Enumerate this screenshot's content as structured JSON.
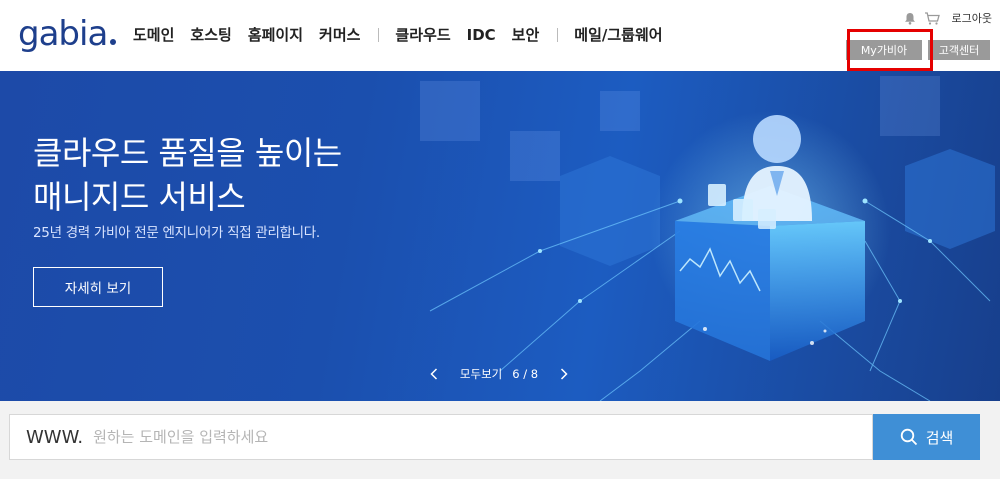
{
  "logo": {
    "text": "gabia"
  },
  "gnb": {
    "items": [
      "도메인",
      "호스팅",
      "홈페이지",
      "커머스",
      "클라우드",
      "IDC",
      "보안",
      "메일/그룹웨어"
    ]
  },
  "util": {
    "bell_icon": "bell-icon",
    "cart_icon": "cart-icon",
    "logout_label": "로그아웃"
  },
  "header_buttons": {
    "mygabia_label": "My가비아",
    "customer_center_label": "고객센터"
  },
  "hero": {
    "title_line1": "클라우드 품질을 높이는",
    "title_line2": "매니지드 서비스",
    "subtitle": "25년 경력 가비아 전문 엔지니어가 직접 관리합니다.",
    "cta_label": "자세히 보기",
    "pager": {
      "all_label": "모두보기",
      "count": "6 / 8",
      "prev_icon": "chevron-left-icon",
      "next_icon": "chevron-right-icon"
    }
  },
  "search": {
    "prefix": "WWW.",
    "placeholder": "원하는 도메인을 입력하세요",
    "value": "",
    "button_label": "검색",
    "button_icon": "search-icon"
  },
  "colors": {
    "brand": "#1e3f8c",
    "hero_bg": "#1b4fae",
    "search_button": "#3f8fd6",
    "header_button": "#9a9a9a",
    "highlight": "#e50000"
  }
}
